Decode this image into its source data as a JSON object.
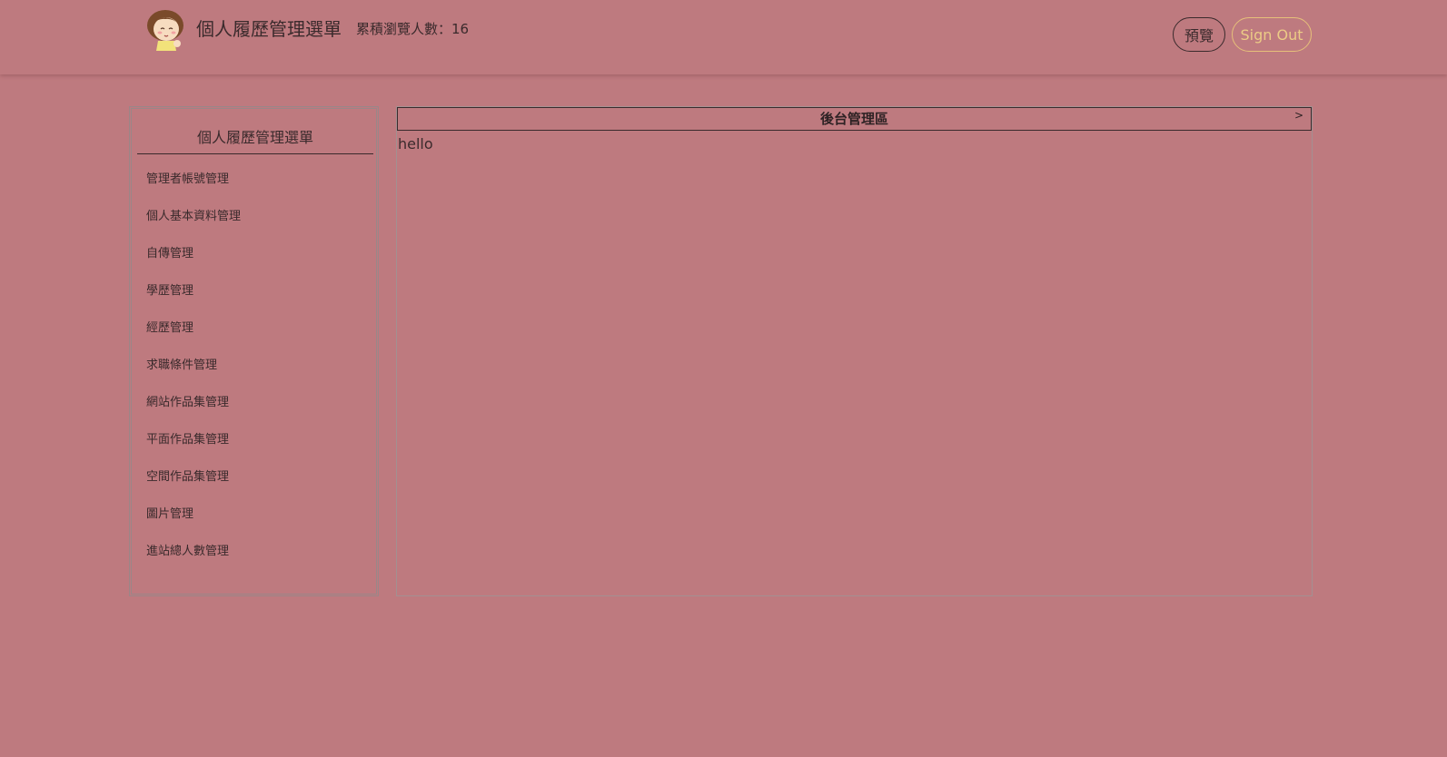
{
  "header": {
    "brand_title": "個人履歷管理選單",
    "visit_label": "累積瀏覽人數：",
    "visit_count": "16",
    "preview_label": "預覽",
    "signout_label": "Sign Out",
    "logo_icon": "cartoon-girl-avatar-icon"
  },
  "sidebar": {
    "title": "個人履歷管理選單",
    "items": [
      {
        "label": "管理者帳號管理"
      },
      {
        "label": "個人基本資料管理"
      },
      {
        "label": "自傳管理"
      },
      {
        "label": "學歷管理"
      },
      {
        "label": "經歷管理"
      },
      {
        "label": "求職條件管理"
      },
      {
        "label": "網站作品集管理"
      },
      {
        "label": "平面作品集管理"
      },
      {
        "label": "空間作品集管理"
      },
      {
        "label": "圖片管理"
      },
      {
        "label": "進站總人數管理"
      }
    ]
  },
  "main": {
    "title": "後台管理區",
    "toggle": ">",
    "content": "hello"
  },
  "colors": {
    "background": "#be7a7f",
    "text": "#3a2a2c",
    "signout_accent": "#e6c07a"
  }
}
